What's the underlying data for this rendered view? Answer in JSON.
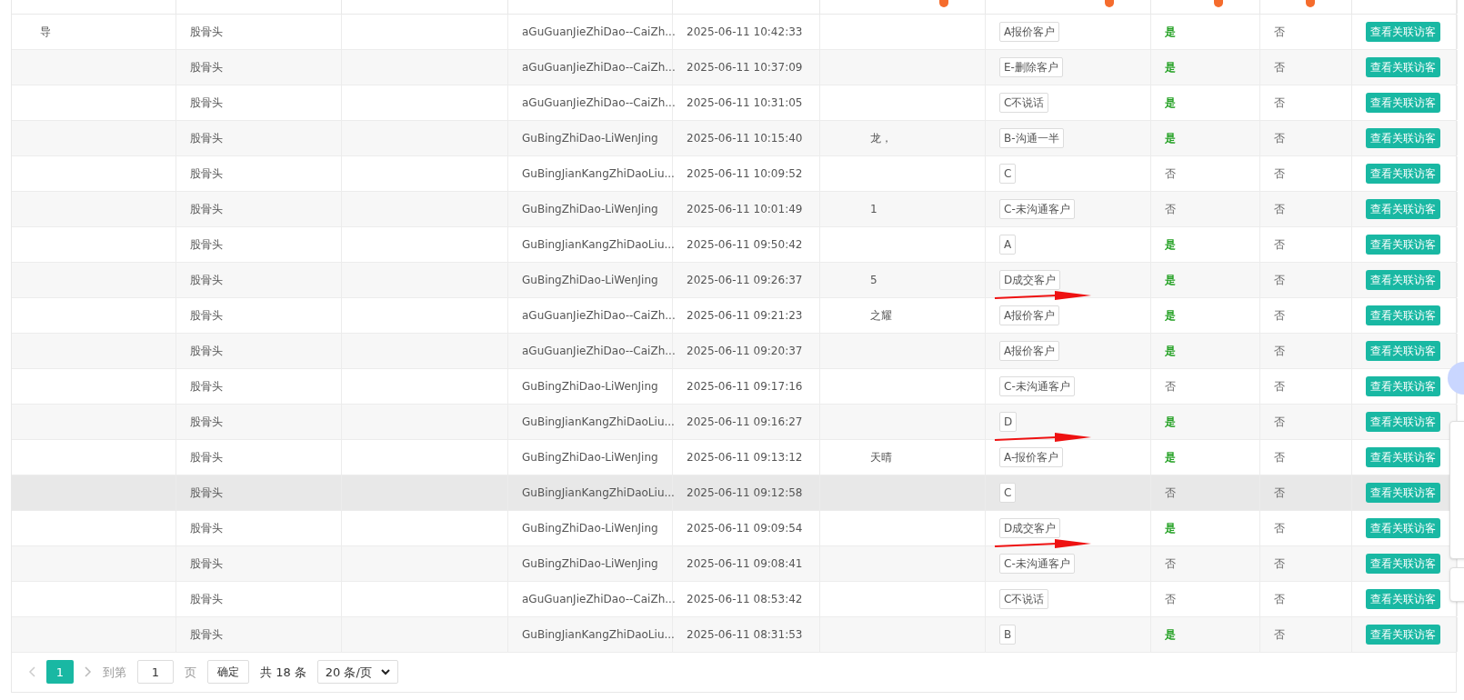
{
  "columns": [
    {
      "info": false
    },
    {
      "info": false
    },
    {
      "info": false
    },
    {
      "info": false
    },
    {
      "info": false
    },
    {
      "info": true
    },
    {
      "info": true
    },
    {
      "info": true
    },
    {
      "info": true
    },
    {
      "info": false
    }
  ],
  "rows": [
    {
      "name": "导",
      "group": "股骨头",
      "column_4": "aGuGuanJieZhiDao--CaiZh...",
      "time": "2025-06-11 10:42:33",
      "tag": "A报价客户",
      "column_8": "是",
      "column_8_positive": true,
      "column_9": "否",
      "action": "查看关联访客",
      "hovered": false,
      "arrow": false
    },
    {
      "group": "股骨头",
      "column_4": "aGuGuanJieZhiDao--CaiZh...",
      "time": "2025-06-11 10:37:09",
      "tag": "E-删除客户",
      "column_8": "是",
      "column_8_positive": true,
      "column_9": "否",
      "action": "查看关联访客",
      "hovered": false,
      "arrow": false
    },
    {
      "group": "股骨头",
      "column_4": "aGuGuanJieZhiDao--CaiZh...",
      "time": "2025-06-11 10:31:05",
      "tag": "C不说话",
      "column_8": "是",
      "column_8_positive": true,
      "column_9": "否",
      "action": "查看关联访客",
      "hovered": false,
      "arrow": false
    },
    {
      "group": "股骨头",
      "column_4": "GuBingZhiDao-LiWenJing",
      "time": "2025-06-11 10:15:40",
      "column_6": "龙，",
      "tag": "B-沟通一半",
      "column_8": "是",
      "column_8_positive": true,
      "column_9": "否",
      "action": "查看关联访客",
      "hovered": false,
      "arrow": false
    },
    {
      "group": "股骨头",
      "column_4": "GuBingJianKangZhiDaoLiu...",
      "time": "2025-06-11 10:09:52",
      "tag": "C",
      "column_8": "否",
      "column_8_positive": false,
      "column_9": "否",
      "action": "查看关联访客",
      "hovered": false,
      "arrow": false
    },
    {
      "group": "股骨头",
      "column_4": "GuBingZhiDao-LiWenJing",
      "time": "2025-06-11 10:01:49",
      "column_6": "1",
      "tag": "C-未沟通客户",
      "column_8": "否",
      "column_8_positive": false,
      "column_9": "否",
      "action": "查看关联访客",
      "hovered": false,
      "arrow": false
    },
    {
      "group": "股骨头",
      "column_4": "GuBingJianKangZhiDaoLiu...",
      "time": "2025-06-11 09:50:42",
      "tag": "A",
      "column_8": "是",
      "column_8_positive": true,
      "column_9": "否",
      "action": "查看关联访客",
      "hovered": false,
      "arrow": false
    },
    {
      "group": "股骨头",
      "column_4": "GuBingZhiDao-LiWenJing",
      "time": "2025-06-11 09:26:37",
      "column_6": "5",
      "tag": "D成交客户",
      "column_8": "是",
      "column_8_positive": true,
      "column_9": "否",
      "action": "查看关联访客",
      "hovered": false,
      "arrow": true
    },
    {
      "group": "股骨头",
      "column_4": "aGuGuanJieZhiDao--CaiZh...",
      "time": "2025-06-11 09:21:23",
      "column_6": "之耀",
      "tag": "A报价客户",
      "column_8": "是",
      "column_8_positive": true,
      "column_9": "否",
      "action": "查看关联访客",
      "hovered": false,
      "arrow": false
    },
    {
      "group": "股骨头",
      "column_4": "aGuGuanJieZhiDao--CaiZh...",
      "time": "2025-06-11 09:20:37",
      "tag": "A报价客户",
      "column_8": "是",
      "column_8_positive": true,
      "column_9": "否",
      "action": "查看关联访客",
      "hovered": false,
      "arrow": false
    },
    {
      "group": "股骨头",
      "column_4": "GuBingZhiDao-LiWenJing",
      "time": "2025-06-11 09:17:16",
      "tag": "C-未沟通客户",
      "column_8": "否",
      "column_8_positive": false,
      "column_9": "否",
      "action": "查看关联访客",
      "hovered": false,
      "arrow": false
    },
    {
      "group": "股骨头",
      "column_4": "GuBingJianKangZhiDaoLiu...",
      "time": "2025-06-11 09:16:27",
      "tag": "D",
      "column_8": "是",
      "column_8_positive": true,
      "column_9": "否",
      "action": "查看关联访客",
      "hovered": false,
      "arrow": true
    },
    {
      "group": "股骨头",
      "column_4": "GuBingZhiDao-LiWenJing",
      "time": "2025-06-11 09:13:12",
      "column_6": "天晴",
      "tag": "A-报价客户",
      "column_8": "是",
      "column_8_positive": true,
      "column_9": "否",
      "action": "查看关联访客",
      "hovered": false,
      "arrow": false
    },
    {
      "group": "股骨头",
      "column_4": "GuBingJianKangZhiDaoLiu...",
      "time": "2025-06-11 09:12:58",
      "tag": "C",
      "column_8": "否",
      "column_8_positive": false,
      "column_9": "否",
      "action": "查看关联访客",
      "hovered": true,
      "arrow": false
    },
    {
      "group": "股骨头",
      "column_4": "GuBingZhiDao-LiWenJing",
      "time": "2025-06-11 09:09:54",
      "tag": "D成交客户",
      "column_8": "是",
      "column_8_positive": true,
      "column_9": "否",
      "action": "查看关联访客",
      "hovered": false,
      "arrow": true
    },
    {
      "group": "股骨头",
      "column_4": "GuBingZhiDao-LiWenJing",
      "time": "2025-06-11 09:08:41",
      "tag": "C-未沟通客户",
      "column_8": "否",
      "column_8_positive": false,
      "column_9": "否",
      "action": "查看关联访客",
      "hovered": false,
      "arrow": false
    },
    {
      "group": "股骨头",
      "column_4": "aGuGuanJieZhiDao--CaiZh...",
      "time": "2025-06-11 08:53:42",
      "tag": "C不说话",
      "column_8": "否",
      "column_8_positive": false,
      "column_9": "否",
      "action": "查看关联访客",
      "hovered": false,
      "arrow": false
    },
    {
      "group": "股骨头",
      "column_4": "GuBingJianKangZhiDaoLiu...",
      "time": "2025-06-11 08:31:53",
      "tag": "B",
      "column_8": "是",
      "column_8_positive": true,
      "column_9": "否",
      "action": "查看关联访客",
      "hovered": false,
      "arrow": false
    }
  ],
  "pagination": {
    "pages": [
      {
        "label": "1",
        "selected": true
      }
    ],
    "goto_label": "到第",
    "goto_value": "1",
    "page_unit": "页",
    "confirm": "确定",
    "total": "共 18 条",
    "page_size": "20 条/页"
  }
}
